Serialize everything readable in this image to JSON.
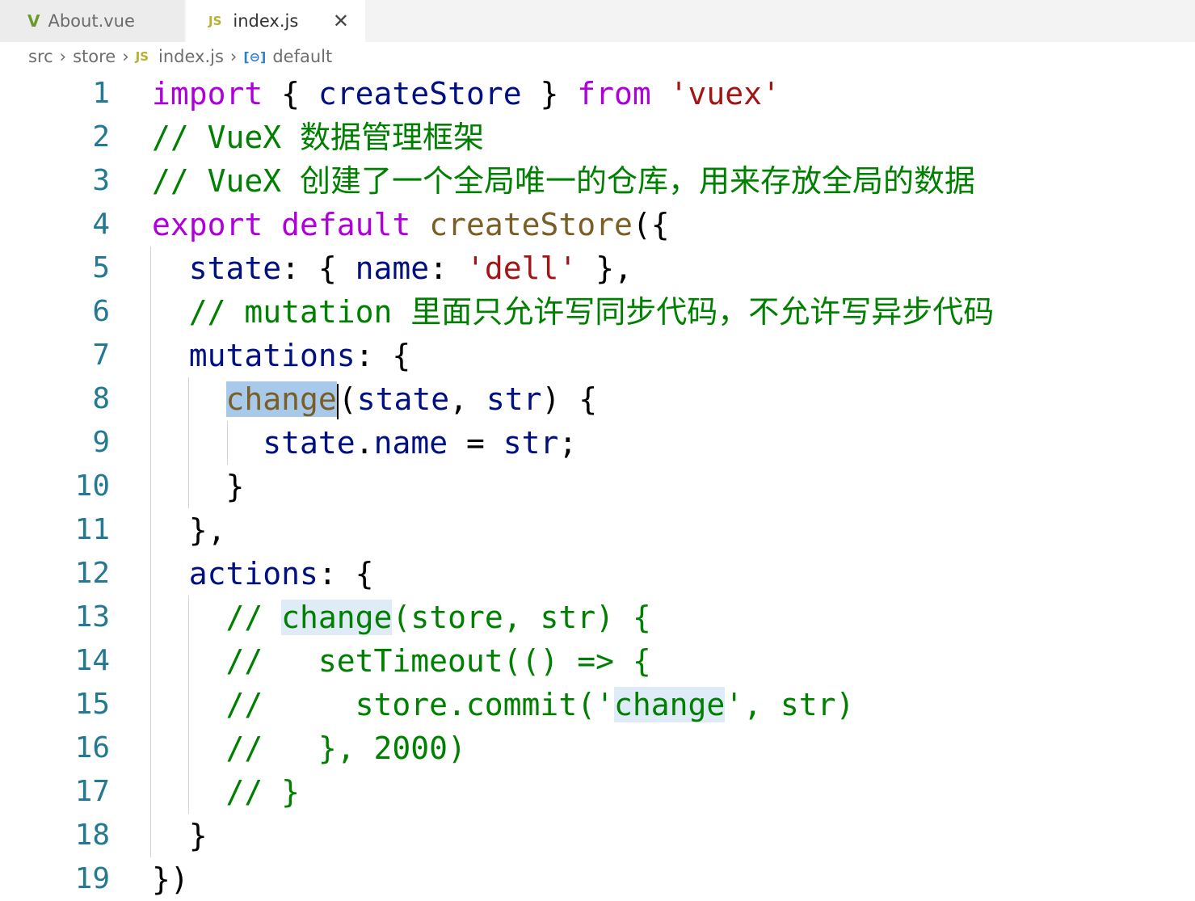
{
  "tabs": [
    {
      "label": "About.vue",
      "icon": "vue-icon"
    },
    {
      "label": "index.js",
      "icon": "js-icon",
      "badge": "JS",
      "active": true
    }
  ],
  "breadcrumb": {
    "items": [
      "src",
      "store",
      "index.js",
      "default"
    ],
    "js_badge": "JS",
    "symbol_icon": "[⊖]"
  },
  "colors": {
    "keyword": "#af00db",
    "identifier": "#001080",
    "comment": "#008000",
    "string": "#a31515",
    "function": "#795e26",
    "line_number": "#237893"
  },
  "lines": [
    {
      "n": "1",
      "tokens": [
        {
          "t": "import",
          "c": "kw"
        },
        {
          "t": " { ",
          "c": "pn"
        },
        {
          "t": "createStore",
          "c": "id"
        },
        {
          "t": " } ",
          "c": "pn"
        },
        {
          "t": "from",
          "c": "kw"
        },
        {
          "t": " ",
          "c": "pn"
        },
        {
          "t": "'vuex'",
          "c": "st"
        }
      ]
    },
    {
      "n": "2",
      "tokens": [
        {
          "t": "// VueX 数据管理框架",
          "c": "cm"
        }
      ]
    },
    {
      "n": "3",
      "tokens": [
        {
          "t": "// VueX 创建了一个全局唯一的仓库，用来存放全局的数据",
          "c": "cm"
        }
      ]
    },
    {
      "n": "4",
      "tokens": [
        {
          "t": "export",
          "c": "kw"
        },
        {
          "t": " ",
          "c": "pn"
        },
        {
          "t": "default",
          "c": "kw"
        },
        {
          "t": " ",
          "c": "pn"
        },
        {
          "t": "createStore",
          "c": "fn"
        },
        {
          "t": "({",
          "c": "pn"
        }
      ]
    },
    {
      "n": "5",
      "tokens": [
        {
          "t": "  ",
          "c": "pn"
        },
        {
          "t": "state",
          "c": "id"
        },
        {
          "t": ": { ",
          "c": "pn"
        },
        {
          "t": "name",
          "c": "id"
        },
        {
          "t": ": ",
          "c": "pn"
        },
        {
          "t": "'dell'",
          "c": "st"
        },
        {
          "t": " },",
          "c": "pn"
        }
      ]
    },
    {
      "n": "6",
      "tokens": [
        {
          "t": "  // mutation 里面只允许写同步代码，不允许写异步代码",
          "c": "cm"
        }
      ]
    },
    {
      "n": "7",
      "tokens": [
        {
          "t": "  ",
          "c": "pn"
        },
        {
          "t": "mutations",
          "c": "id"
        },
        {
          "t": ": {",
          "c": "pn"
        }
      ]
    },
    {
      "n": "8",
      "tokens": [
        {
          "t": "    ",
          "c": "pn"
        },
        {
          "t": "change",
          "c": "fn sel"
        },
        {
          "t": "",
          "c": "cursor"
        },
        {
          "t": "(",
          "c": "pn"
        },
        {
          "t": "state",
          "c": "id"
        },
        {
          "t": ", ",
          "c": "pn"
        },
        {
          "t": "str",
          "c": "id"
        },
        {
          "t": ") {",
          "c": "pn"
        }
      ]
    },
    {
      "n": "9",
      "tokens": [
        {
          "t": "      ",
          "c": "pn"
        },
        {
          "t": "state",
          "c": "id"
        },
        {
          "t": ".",
          "c": "pn"
        },
        {
          "t": "name",
          "c": "id"
        },
        {
          "t": " = ",
          "c": "pn"
        },
        {
          "t": "str",
          "c": "id"
        },
        {
          "t": ";",
          "c": "pn"
        }
      ]
    },
    {
      "n": "10",
      "tokens": [
        {
          "t": "    }",
          "c": "pn"
        }
      ]
    },
    {
      "n": "11",
      "tokens": [
        {
          "t": "  },",
          "c": "pn"
        }
      ]
    },
    {
      "n": "12",
      "tokens": [
        {
          "t": "  ",
          "c": "pn"
        },
        {
          "t": "actions",
          "c": "id"
        },
        {
          "t": ": {",
          "c": "pn"
        }
      ]
    },
    {
      "n": "13",
      "tokens": [
        {
          "t": "    // ",
          "c": "cm"
        },
        {
          "t": "change",
          "c": "cm hl"
        },
        {
          "t": "(store, str) {",
          "c": "cm"
        }
      ]
    },
    {
      "n": "14",
      "tokens": [
        {
          "t": "    //   setTimeout(() => {",
          "c": "cm"
        }
      ]
    },
    {
      "n": "15",
      "tokens": [
        {
          "t": "    //     store.commit('",
          "c": "cm"
        },
        {
          "t": "change",
          "c": "cm hl"
        },
        {
          "t": "', str)",
          "c": "cm"
        }
      ]
    },
    {
      "n": "16",
      "tokens": [
        {
          "t": "    //   }, 2000)",
          "c": "cm"
        }
      ]
    },
    {
      "n": "17",
      "tokens": [
        {
          "t": "    // }",
          "c": "cm"
        }
      ]
    },
    {
      "n": "18",
      "tokens": [
        {
          "t": "  }",
          "c": "pn"
        }
      ]
    },
    {
      "n": "19",
      "tokens": [
        {
          "t": "})",
          "c": "pn"
        }
      ]
    }
  ]
}
